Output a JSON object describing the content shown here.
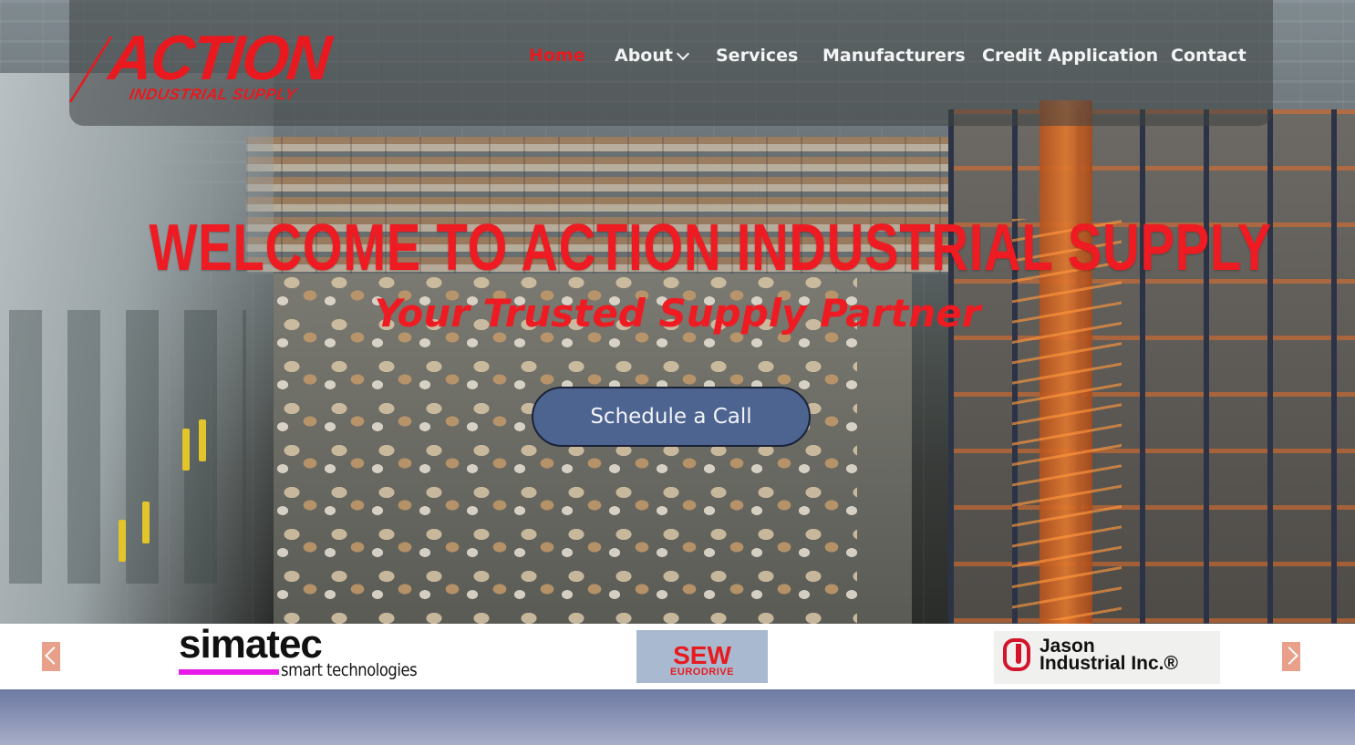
{
  "colors": {
    "brand_red": "#ee1b22",
    "header_overlay": "rgba(62,66,66,0.55)",
    "cta_bg": "#4d6390",
    "nav_text": "#f3f4f4",
    "bottom_strip": "#7c86ad"
  },
  "logo": {
    "name": "ACTION",
    "tagline": "INDUSTRIAL SUPPLY"
  },
  "nav": {
    "items": [
      {
        "label": "Home",
        "active": true
      },
      {
        "label": "About",
        "has_dropdown": true,
        "icon": "chevron-down-icon"
      },
      {
        "label": "Services"
      },
      {
        "label": "Manufacturers"
      },
      {
        "label": "Credit Application"
      },
      {
        "label": "Contact"
      }
    ]
  },
  "hero": {
    "title": "WELCOME TO ACTION INDUSTRIAL SUPPLY",
    "subtitle": "Your Trusted Supply Partner",
    "cta_label": "Schedule a Call"
  },
  "carousel": {
    "prev_icon": "chevron-left-icon",
    "next_icon": "chevron-right-icon",
    "brands": [
      {
        "name": "simatec",
        "tagline": "smart technologies"
      },
      {
        "name": "SEW",
        "tagline": "EURODRIVE"
      },
      {
        "name": "Jason",
        "tagline": "Industrial Inc.®"
      }
    ]
  }
}
